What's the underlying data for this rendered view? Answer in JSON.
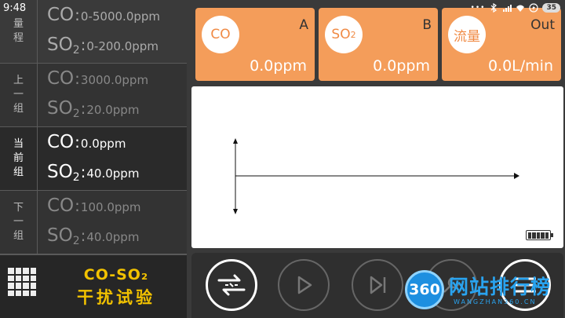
{
  "status": {
    "time": "9:48",
    "battery": "35"
  },
  "groups": [
    {
      "side": [
        "量",
        "程"
      ],
      "co_label": "CO",
      "co_value": "0-5000.0ppm",
      "so2_label": "SO",
      "so2_sub": "2",
      "so2_value": "0-200.0ppm"
    },
    {
      "side": [
        "上",
        "一",
        "组"
      ],
      "co_label": "CO",
      "co_value": "3000.0ppm",
      "so2_label": "SO",
      "so2_sub": "2",
      "so2_value": "20.0ppm"
    },
    {
      "side": [
        "当",
        "前",
        "组"
      ],
      "co_label": "CO",
      "co_value": "0.0ppm",
      "so2_label": "SO",
      "so2_sub": "2",
      "so2_value": "40.0ppm"
    },
    {
      "side": [
        "下",
        "一",
        "组"
      ],
      "co_label": "CO",
      "co_value": "100.0ppm",
      "so2_label": "SO",
      "so2_sub": "2",
      "so2_value": "40.0ppm"
    }
  ],
  "colon": ":",
  "brand": {
    "line1": "CO-SO₂",
    "line2": "干扰试验"
  },
  "cards": [
    {
      "circle": "CO",
      "circle_sub": "",
      "tag": "A",
      "reading": "0.0ppm"
    },
    {
      "circle": "SO",
      "circle_sub": "2",
      "tag": "B",
      "reading": "0.0ppm"
    },
    {
      "circle": "流量",
      "circle_sub": "",
      "tag": "Out",
      "reading": "0.0L/min"
    }
  ],
  "watermark": {
    "logo": "360",
    "text": "网站排行榜",
    "sub": "WANGZHAN360.CN"
  },
  "colors": {
    "card": "#f49d5a",
    "brand": "#f2c200",
    "watermark": "#29a3ef"
  }
}
